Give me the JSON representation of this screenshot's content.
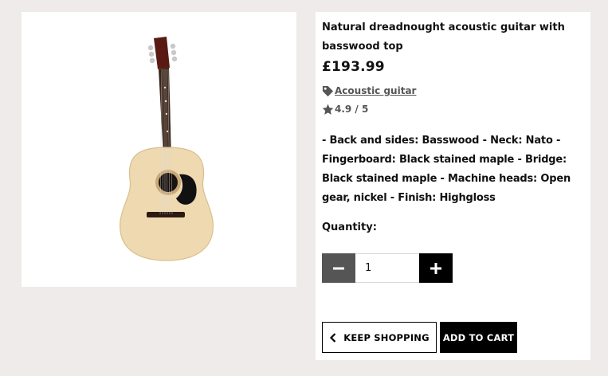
{
  "product": {
    "title": "Natural dreadnought acoustic guitar with basswood top",
    "price": "£193.99",
    "category": "Acoustic guitar",
    "rating": "4.9 / 5",
    "description": "- Back and sides: Basswood - Neck: Nato - Fingerboard: Black stained maple - Bridge: Black stained maple - Machine heads: Open gear, nickel - Finish: Highgloss"
  },
  "quantity": {
    "label": "Quantity:",
    "value": "1"
  },
  "actions": {
    "keep_shopping": "KEEP SHOPPING",
    "add_to_cart": "ADD TO CART"
  },
  "icons": {
    "category": "tag-icon",
    "rating": "star-icon",
    "minus": "minus-icon",
    "plus": "plus-icon",
    "back": "chevron-left-icon"
  }
}
